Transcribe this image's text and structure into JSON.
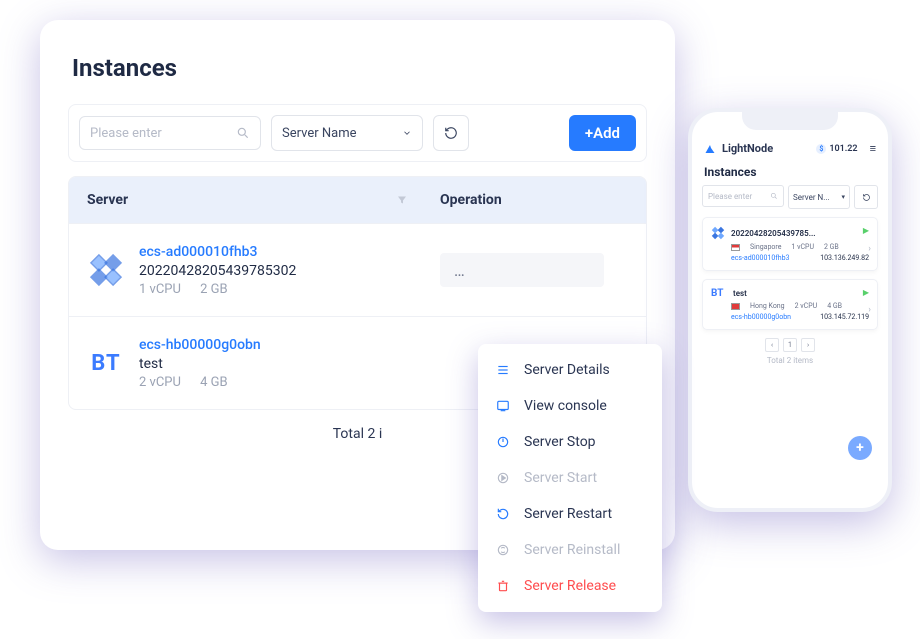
{
  "page_title": "Instances",
  "search": {
    "placeholder": "Please enter"
  },
  "select": {
    "label": "Server Name"
  },
  "add_button": "+Add",
  "columns": {
    "server": "Server",
    "operation": "Operation"
  },
  "rows": [
    {
      "id": "ecs-ad000010fhb3",
      "name": "20220428205439785302",
      "vcpu": "1 vCPU",
      "ram": "2 GB",
      "os_icon": "centos"
    },
    {
      "id": "ecs-hb00000g0obn",
      "name": "test",
      "vcpu": "2 vCPU",
      "ram": "4 GB",
      "os_icon": "bt"
    }
  ],
  "op_btn": "…",
  "footer": "Total 2 i",
  "menu": [
    {
      "label": "Server Details",
      "state": "normal",
      "icon": "details"
    },
    {
      "label": "View console",
      "state": "normal",
      "icon": "console"
    },
    {
      "label": "Server Stop",
      "state": "normal",
      "icon": "power"
    },
    {
      "label": "Server Start",
      "state": "disabled",
      "icon": "play"
    },
    {
      "label": "Server Restart",
      "state": "normal",
      "icon": "restart"
    },
    {
      "label": "Server Reinstall",
      "state": "disabled",
      "icon": "reinstall"
    },
    {
      "label": "Server Release",
      "state": "danger",
      "icon": "trash"
    }
  ],
  "phone": {
    "brand": "LightNode",
    "balance": "101.22",
    "title": "Instances",
    "search_placeholder": "Please enter",
    "select_label": "Server N...",
    "cards": [
      {
        "name": "20220428205439785...",
        "region": "Singapore",
        "vcpu": "1 vCPU",
        "ram": "2 GB",
        "id": "ecs-ad000010fhb3",
        "ip": "103.136.249.82",
        "flag": "sg",
        "os": "centos"
      },
      {
        "name": "test",
        "region": "Hong Kong",
        "vcpu": "2 vCPU",
        "ram": "4 GB",
        "id": "ecs-hb00000g0obn",
        "ip": "103.145.72.119",
        "flag": "hk",
        "os": "bt"
      }
    ],
    "bt_label": "BT",
    "pager_prev": "‹",
    "pager_page": "1",
    "pager_next": "›",
    "total": "Total 2 items"
  },
  "bt_label": "BT"
}
